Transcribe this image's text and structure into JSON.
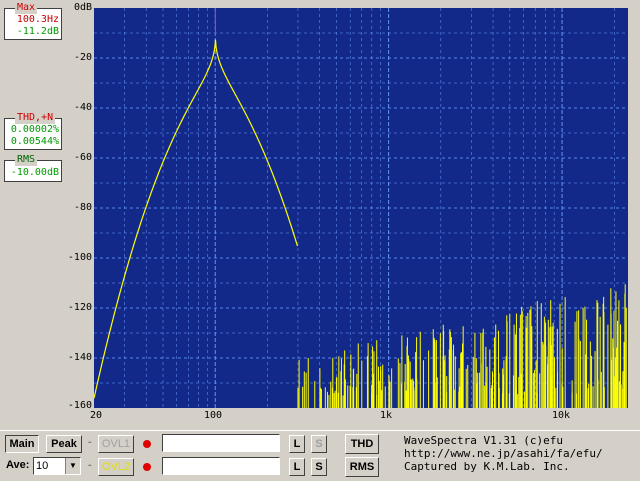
{
  "readouts": {
    "max": {
      "title": "Max",
      "freq": "100.3Hz",
      "level": "-11.2dB"
    },
    "thd": {
      "title": "THD,+N",
      "v1": "0.00002%",
      "v2": "0.00544%"
    },
    "rms": {
      "title": "RMS",
      "value": "-10.00dB"
    }
  },
  "axes": {
    "y_ticks": [
      "0dB",
      "-20",
      "-40",
      "-60",
      "-80",
      "-100",
      "-120",
      "-140",
      "-160"
    ],
    "x_ticks": [
      "20",
      "100",
      "1k",
      "10k"
    ]
  },
  "controls": {
    "main": "Main",
    "peak": "Peak",
    "ave_label": "Ave:",
    "ave_value": "10",
    "dash": "-",
    "ovl1": "OVL1",
    "ovl2": "OVL2",
    "L": "L",
    "S": "S",
    "thd": "THD",
    "rms": "RMS"
  },
  "info": {
    "line1": "WaveSpectra V1.31 (c)efu",
    "line2": "http://www.ne.jp/asahi/fa/efu/",
    "line3": "Captured by K.M.Lab. Inc."
  },
  "colors": {
    "plot_bg": "#12298a",
    "grid": "#6ea0ff",
    "trace": "#ffff00",
    "marker": "#ff3030"
  }
}
